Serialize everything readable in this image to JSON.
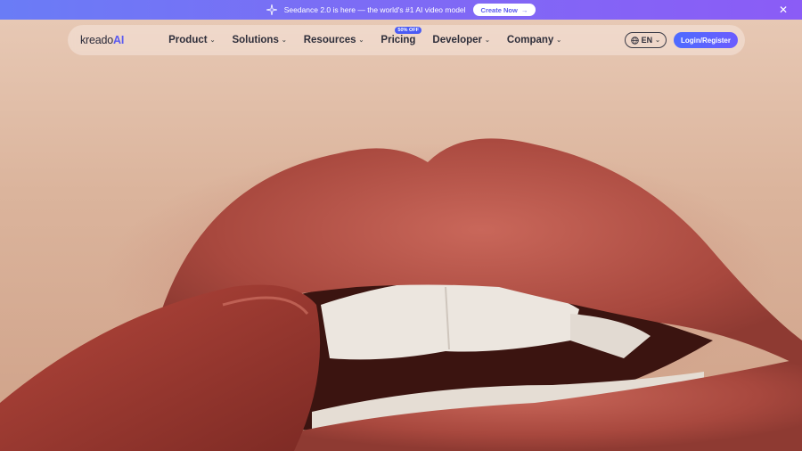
{
  "announcement": {
    "text": "Seedance 2.0 is here — the world's #1 AI video model",
    "cta_label": "Create Now",
    "cta_arrow": "→",
    "close_glyph": "✕"
  },
  "nav": {
    "logo_main": "kreado",
    "logo_ai": "AI",
    "items": [
      {
        "label": "Product",
        "chevron": "⌄"
      },
      {
        "label": "Solutions",
        "chevron": "⌄"
      },
      {
        "label": "Resources",
        "chevron": "⌄"
      },
      {
        "label": "Pricing",
        "badge": "50% OFF"
      },
      {
        "label": "Developer",
        "chevron": "⌄"
      },
      {
        "label": "Company",
        "chevron": "⌄"
      }
    ],
    "language": "EN",
    "language_chevron": "⌄",
    "login_label": "Login/Register"
  },
  "hero": {
    "image_subject": "close-up of lips with red lipstick",
    "colors": {
      "lip": "#b4564a",
      "skin": "#dbb49c",
      "teeth": "#ece6df",
      "accent": "#5b5bf0"
    }
  }
}
